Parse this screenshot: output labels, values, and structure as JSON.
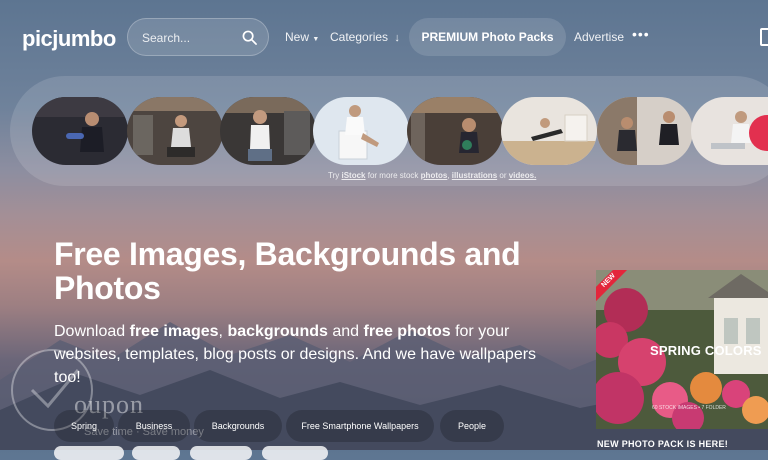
{
  "header": {
    "logo": "picjumbo",
    "search_placeholder": "Search...",
    "nav_new": "New",
    "nav_categories": "Categories",
    "premium_label": "PREMIUM Photo Packs",
    "nav_advertise": "Advertise",
    "more_label": "•••"
  },
  "strip": {
    "thumbnails": [
      "photo-gym-dumbbell-curl",
      "photo-gym-seated-dumbbell",
      "photo-gym-bench-woman",
      "photo-woman-sitting-box",
      "photo-gym-kettlebell",
      "photo-home-plank",
      "photo-gym-mirror-row",
      "photo-laptop-desk"
    ],
    "note_prefix": "Try",
    "note_brand": "iStock",
    "note_mid": "for more stock",
    "note_link1": "photos",
    "note_link2": "illustrations",
    "note_or": "or",
    "note_link3": "videos."
  },
  "hero": {
    "title": "Free Images, Backgrounds and Photos",
    "text_1": "Download ",
    "bold_1": "free images",
    "text_2": ", ",
    "bold_2": "backgrounds",
    "text_3": " and ",
    "bold_3": "free photos",
    "text_4": " for your websites, templates, blog posts or designs. And we have wallpapers too!"
  },
  "tags": [
    "Spring",
    "Business",
    "Backgrounds",
    "Free Smartphone Wallpapers",
    "People"
  ],
  "watermark": {
    "text": "oupon",
    "sub": "Save time · Save money"
  },
  "promo": {
    "ribbon": "NEW",
    "title": "SPRING COLORS",
    "small": "60 STOCK IMAGES • 7 FOLDER",
    "caption": "NEW PHOTO PACK IS HERE!"
  },
  "colors": {
    "ribbon": "#e3263b",
    "flowers": "#c93763"
  }
}
